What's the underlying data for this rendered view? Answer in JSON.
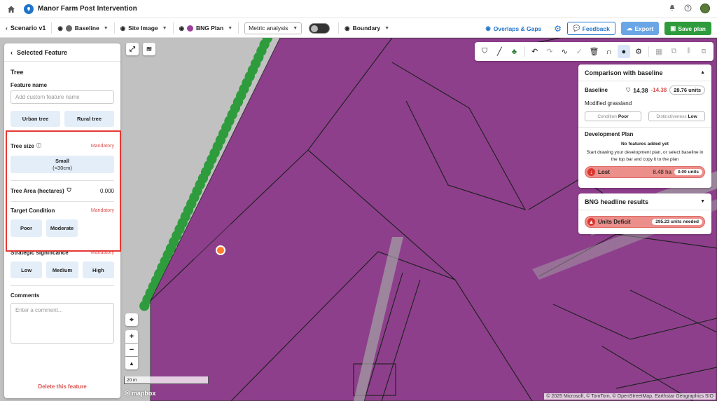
{
  "app": {
    "title": "Manor Farm Post Intervention"
  },
  "toolbar": {
    "scenario": "Scenario v1",
    "baseline": "Baseline",
    "site_image": "Site Image",
    "bng_plan": "BNG Plan",
    "metric_select": "Metric analysis",
    "boundary": "Boundary",
    "overlaps": "Overlaps & Gaps",
    "feedback": "Feedback",
    "export": "Export",
    "save": "Save plan",
    "colors": {
      "baseline_dot": "#666666",
      "bng_dot": "#9c3f9c",
      "accent": "#1f74c9",
      "save": "#2e9c3c"
    }
  },
  "panel": {
    "header": "Selected Feature",
    "feature_type": "Tree",
    "feature_name_label": "Feature name",
    "feature_name_placeholder": "Add custom feature name",
    "tree_types": [
      "Urban tree",
      "Rural tree"
    ],
    "tree_size_label": "Tree size",
    "mandatory": "Mandatory",
    "tree_size_option_line1": "Small",
    "tree_size_option_line2": "(<30cm)",
    "tree_area_label": "Tree Area (hectares)",
    "tree_area_value": "0.000",
    "target_condition_label": "Target Condition",
    "conditions": [
      "Poor",
      "Moderate"
    ],
    "strategic_label": "Strategic significance",
    "strategic_options": [
      "Low",
      "Medium",
      "High"
    ],
    "comments_label": "Comments",
    "comments_placeholder": "Enter a comment...",
    "delete": "Delete this feature"
  },
  "comparison": {
    "title": "Comparison with baseline",
    "baseline_label": "Baseline",
    "baseline_value": "14.38",
    "baseline_delta": "-14.38",
    "baseline_units": "28.76 units",
    "habitat": "Modified grassland",
    "condition_label": "Condition",
    "condition_value": "Poor",
    "distinctiveness_label": "Distinctiveness",
    "distinctiveness_value": "Low",
    "dev_plan_title": "Development Plan",
    "no_features": "No features added yet",
    "instructions": "Start drawing your development plan, or select baseline in the top bar and copy it to the plan",
    "lost_label": "Lost",
    "lost_value": "8.48 ha",
    "lost_units": "0.00 units"
  },
  "headline": {
    "title": "BNG headline results",
    "deficit_label": "Units Deficit",
    "deficit_value": "295.23 units needed"
  },
  "map": {
    "scale": "20 m",
    "attribution": "© 2025 Microsoft, © TomTom, © OpenStreetMap, Earthstar Geographics SIO",
    "logo": "mapbox",
    "colors": {
      "habitat": "#8e3f8c",
      "hedge": "#2e9c3c",
      "tree_marker": "#ff7a2a"
    }
  }
}
